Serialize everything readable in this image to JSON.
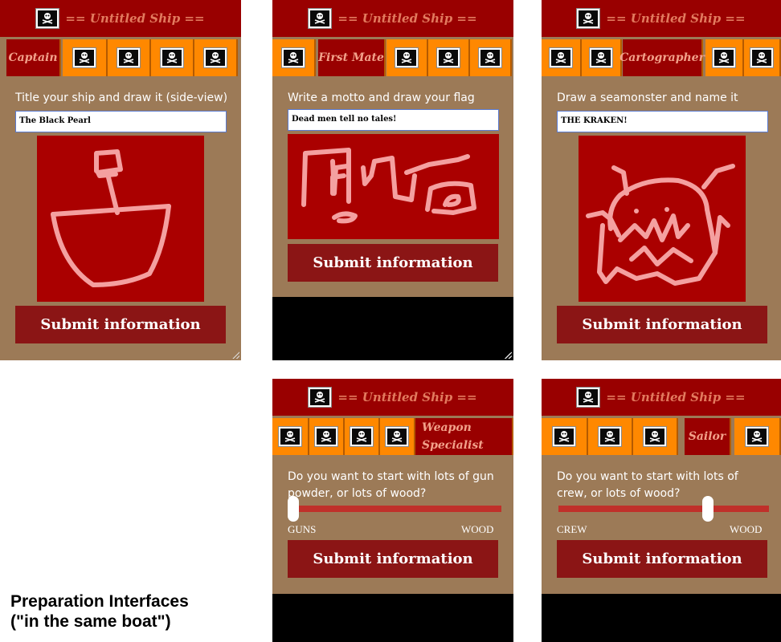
{
  "ship_title": "== Untitled Ship ==",
  "submit_label": "Submit information",
  "caption": {
    "line1": "Preparation Interfaces",
    "line2": "(\"in the same boat\")"
  },
  "colors": {
    "header": "#990000",
    "tab": "#ff8800",
    "panel": "#9c7a57",
    "canvas": "#aa0000",
    "submit": "#8b1515",
    "ink": "#f4a0a0"
  },
  "panels": {
    "captain": {
      "tab_label": "Captain",
      "prompt": "Title your ship and draw it (side-view)",
      "input_value": "The Black Pearl",
      "drawing": "ship"
    },
    "first_mate": {
      "tab_label": "First Mate",
      "prompt": "Write a motto and draw your flag",
      "input_value": "Dead men tell no tales!",
      "drawing": "flag"
    },
    "cartographer": {
      "tab_label": "Cartographer",
      "prompt": "Draw a seamonster and name it",
      "input_value": "THE KRAKEN!",
      "drawing": "seamonster"
    },
    "weapon_specialist": {
      "tab_label": "Weapon Specialist",
      "tab_line1": "Weapon",
      "tab_line2": "Specialist",
      "prompt": "Do you want to start with lots of gun powder, or lots of wood?",
      "slider_min_label": "GUNS",
      "slider_max_label": "WOOD",
      "slider_value": 0.0
    },
    "sailor": {
      "tab_label": "Sailor",
      "prompt": "Do you want to start with lots of crew, or lots of wood?",
      "slider_min_label": "CREW",
      "slider_max_label": "WOOD",
      "slider_value": 0.72
    }
  }
}
